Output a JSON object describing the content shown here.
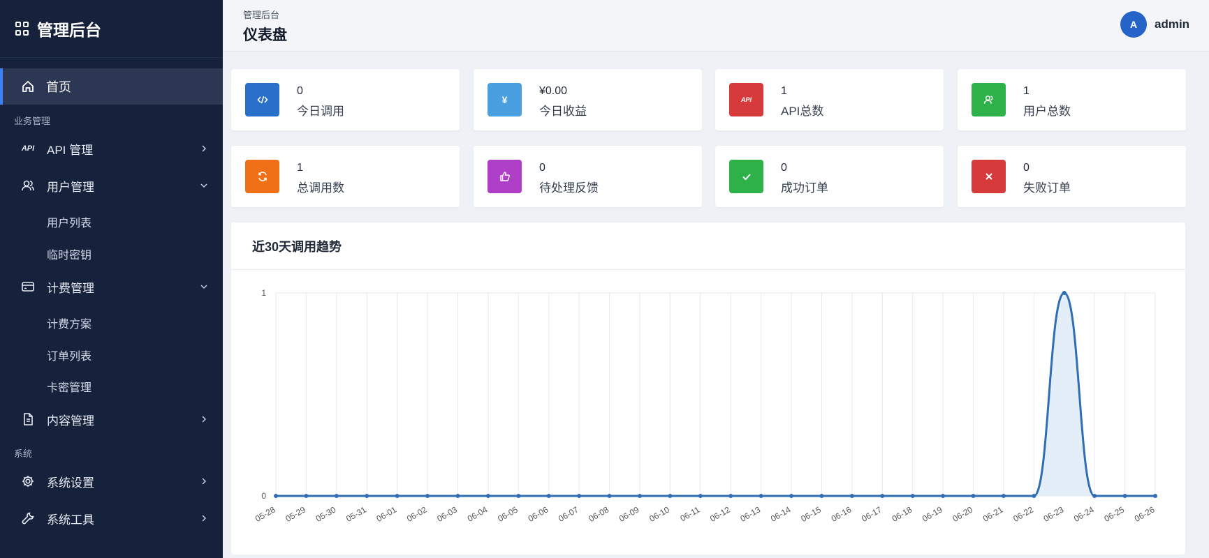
{
  "brand": {
    "title": "管理后台"
  },
  "sidebar": {
    "active": {
      "label": "首页",
      "icon": "home-icon"
    },
    "group_business": "业务管理",
    "api": {
      "label": "API 管理",
      "icon": "api-icon"
    },
    "users": {
      "label": "用户管理",
      "icon": "users-icon"
    },
    "user_list": "用户列表",
    "temp_keys": "临时密钥",
    "billing": {
      "label": "计费管理",
      "icon": "credit-card-icon"
    },
    "plans": "计费方案",
    "orders": "订单列表",
    "cards": "卡密管理",
    "content": {
      "label": "内容管理",
      "icon": "document-icon"
    },
    "group_system": "系统",
    "settings": {
      "label": "系统设置",
      "icon": "gear-icon"
    },
    "tools": {
      "label": "系统工具",
      "icon": "wrench-icon"
    }
  },
  "header": {
    "breadcrumb": "管理后台",
    "title": "仪表盘",
    "avatar_letter": "A",
    "username": "admin"
  },
  "stats": [
    {
      "value": "0",
      "label": "今日调用",
      "icon": "code-icon",
      "color": "#2a6fc9"
    },
    {
      "value": "¥0.00",
      "label": "今日收益",
      "icon": "yen-icon",
      "color": "#4a9fe0"
    },
    {
      "value": "1",
      "label": "API总数",
      "icon": "api-icon",
      "color": "#d63a3a"
    },
    {
      "value": "1",
      "label": "用户总数",
      "icon": "users-icon",
      "color": "#2fb14a"
    },
    {
      "value": "1",
      "label": "总调用数",
      "icon": "refresh-icon",
      "color": "#f07017"
    },
    {
      "value": "0",
      "label": "待处理反馈",
      "icon": "thumbs-up-icon",
      "color": "#b03fc7"
    },
    {
      "value": "0",
      "label": "成功订单",
      "icon": "check-icon",
      "color": "#2fb14a"
    },
    {
      "value": "0",
      "label": "失败订单",
      "icon": "close-icon",
      "color": "#d63a3a"
    }
  ],
  "chart_panel": {
    "title": "近30天调用趋势"
  },
  "chart_data": {
    "type": "area",
    "categories": [
      "05-28",
      "05-29",
      "05-30",
      "05-31",
      "06-01",
      "06-02",
      "06-03",
      "06-04",
      "06-05",
      "06-06",
      "06-07",
      "06-08",
      "06-09",
      "06-10",
      "06-11",
      "06-12",
      "06-13",
      "06-14",
      "06-15",
      "06-16",
      "06-17",
      "06-18",
      "06-19",
      "06-20",
      "06-21",
      "06-22",
      "06-23",
      "06-24",
      "06-25",
      "06-26"
    ],
    "values": [
      0,
      0,
      0,
      0,
      0,
      0,
      0,
      0,
      0,
      0,
      0,
      0,
      0,
      0,
      0,
      0,
      0,
      0,
      0,
      0,
      0,
      0,
      0,
      0,
      0,
      0,
      1,
      0,
      0,
      0
    ],
    "ylim": [
      0,
      1
    ],
    "yticks": [
      "0",
      "1"
    ],
    "grid": true,
    "line_color": "#2f6db5",
    "fill_color": "#e3eef9"
  }
}
